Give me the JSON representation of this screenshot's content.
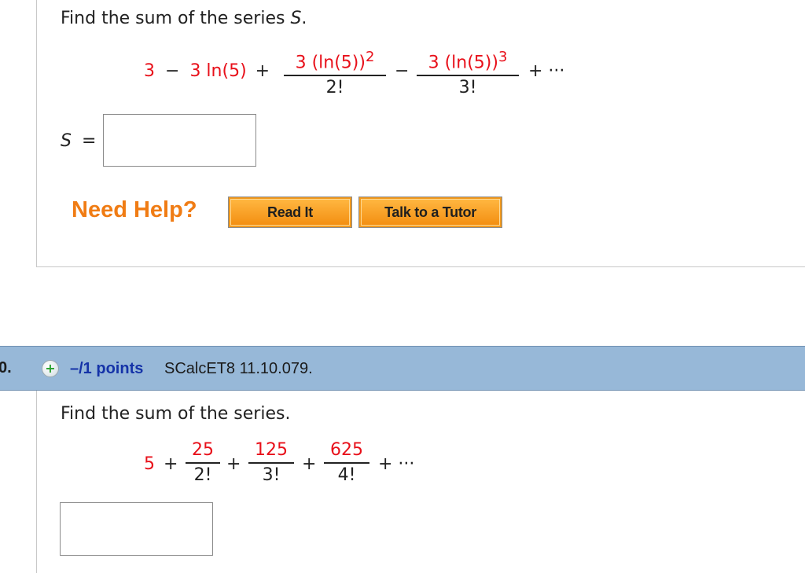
{
  "question_9": {
    "prompt_text": "Find the sum of the series ",
    "prompt_var": "S",
    "prompt_end": ".",
    "series": {
      "term1": "3",
      "op1": "−",
      "term2": "3 ln(5)",
      "op2": "+",
      "frac1_num": "3 (ln(5))",
      "frac1_exp": "2",
      "frac1_den": "2!",
      "op3": "−",
      "frac2_num": "3 (ln(5))",
      "frac2_exp": "3",
      "frac2_den": "3!",
      "tail": "+ ···"
    },
    "answer_label_var": "S",
    "answer_label_eq": "=",
    "answer_value": "",
    "help": {
      "label": "Need Help?",
      "read_it": "Read It",
      "talk_to_tutor": "Talk to a Tutor"
    }
  },
  "question_10": {
    "number": "0.",
    "points": "–/1 points",
    "reference": "SCalcET8 11.10.079.",
    "prompt_text": "Find the sum of the series.",
    "series": {
      "lead": "5",
      "op1": "+",
      "f1_num": "25",
      "f1_den": "2!",
      "op2": "+",
      "f2_num": "125",
      "f2_den": "3!",
      "op3": "+",
      "f3_num": "625",
      "f3_den": "4!",
      "tail": "+ ···"
    },
    "answer_value": ""
  },
  "colors": {
    "red_math": "#e8101a",
    "help_orange": "#f07c14",
    "button_orange": "#f29a1e",
    "header_blue": "#97b8d8",
    "points_blue": "#1533a8"
  }
}
